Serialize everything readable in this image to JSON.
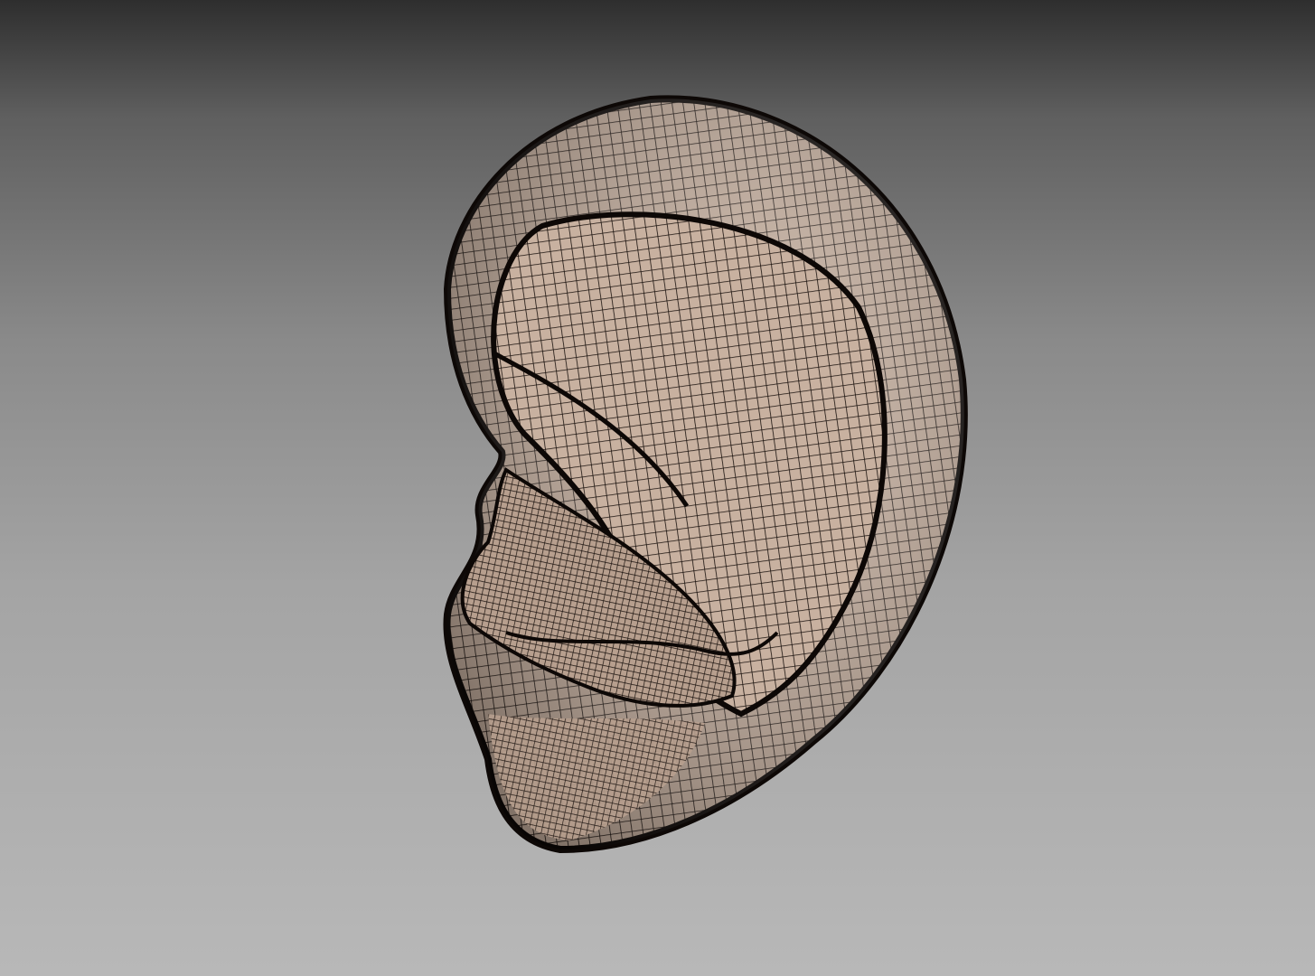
{
  "colors": {
    "background_top": "#2e2e2e",
    "background_bottom": "#b8b8b8",
    "mesh_surface": "#c8b1a0",
    "mesh_lines": "#1a120e"
  }
}
